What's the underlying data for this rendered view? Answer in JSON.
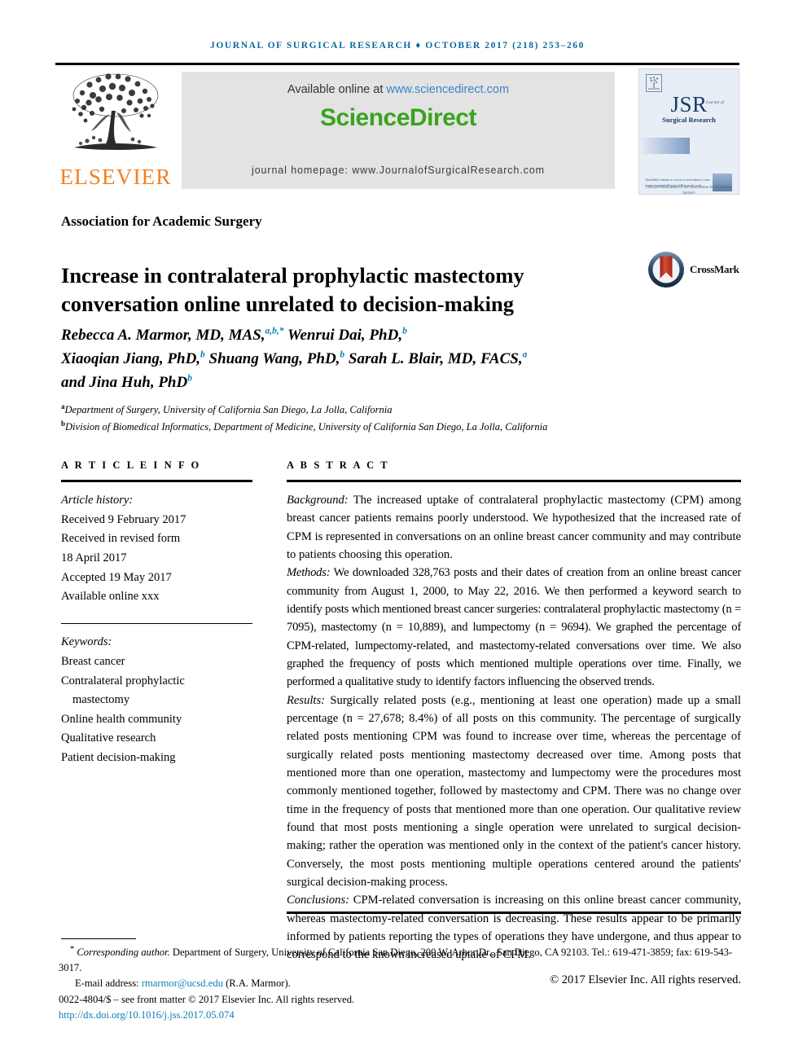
{
  "running_head": "JOURNAL OF SURGICAL RESEARCH ♦ OCTOBER 2017 (218) 253–260",
  "masthead": {
    "publisher_name": "ELSEVIER",
    "available_prefix": "Available online at",
    "sciencedirect_url": "www.sciencedirect.com",
    "sciencedirect_logo": "ScienceDirect",
    "journal_homepage": "journal homepage: www.JournalofSurgicalResearch.com",
    "cover": {
      "acronym": "JSR",
      "journal_word": "Journal of",
      "subtitle": "Surgical Research",
      "official_note": "Official Publication of the\nAssociation for Academic Surgery",
      "footer_note": "Available online at www.sciencedirect.com\nwww.JournalofSurgicalResearch.com"
    }
  },
  "society": "Association for Academic Surgery",
  "title": "Increase in contralateral prophylactic mastectomy conversation online unrelated to decision-making",
  "crossmark": {
    "label": "CrossMark"
  },
  "authors_line_1": "Rebecca A. Marmor, MD, MAS,",
  "authors": {
    "line1_sup": "a,b,*",
    "line1_rest": " Wenrui Dai, PhD,",
    "line1_rest_sup": "b",
    "line2_a": "Xiaoqian Jiang, PhD,",
    "line2_a_sup": "b",
    "line2_b": " Shuang Wang, PhD,",
    "line2_b_sup": "b",
    "line2_c": " Sarah L. Blair, MD, FACS,",
    "line2_c_sup": "a",
    "line3": "and Jina Huh, PhD",
    "line3_sup": "b"
  },
  "affiliations": [
    {
      "marker": "a",
      "text": "Department of Surgery, University of California San Diego, La Jolla, California"
    },
    {
      "marker": "b",
      "text": "Division of Biomedical Informatics, Department of Medicine, University of California San Diego, La Jolla, California"
    }
  ],
  "article_info": {
    "heading": "A R T I C L E   I N F O",
    "history_label": "Article history:",
    "history": [
      "Received 9 February 2017",
      "Received in revised form",
      "18 April 2017",
      "Accepted 19 May 2017",
      "Available online xxx"
    ],
    "keywords_label": "Keywords:",
    "keywords": [
      "Breast cancer",
      "Contralateral prophylactic",
      "mastectomy",
      "Online health community",
      "Qualitative research",
      "Patient decision-making"
    ]
  },
  "abstract": {
    "heading": "A B S T R A C T",
    "background_label": "Background:",
    "background": " The increased uptake of contralateral prophylactic mastectomy (CPM) among breast cancer patients remains poorly understood. We hypothesized that the increased rate of CPM is represented in conversations on an online breast cancer community and may contribute to patients choosing this operation.",
    "methods_label": "Methods:",
    "methods": " We downloaded 328,763 posts and their dates of creation from an online breast cancer community from August 1, 2000, to May 22, 2016. We then performed a keyword search to identify posts which mentioned breast cancer surgeries: contralateral prophylactic mastectomy (n = 7095), mastectomy (n = 10,889), and lumpectomy (n = 9694). We graphed the percentage of CPM-related, lumpectomy-related, and mastectomy-related conversations over time. We also graphed the frequency of posts which mentioned multiple operations over time. Finally, we performed a qualitative study to identify factors influencing the observed trends.",
    "results_label": "Results:",
    "results": " Surgically related posts (e.g., mentioning at least one operation) made up a small percentage (n = 27,678; 8.4%) of all posts on this community. The percentage of surgically related posts mentioning CPM was found to increase over time, whereas the percentage of surgically related posts mentioning mastectomy decreased over time. Among posts that mentioned more than one operation, mastectomy and lumpectomy were the procedures most commonly mentioned together, followed by mastectomy and CPM. There was no change over time in the frequency of posts that mentioned more than one operation. Our qualitative review found that most posts mentioning a single operation were unrelated to surgical decision-making; rather the operation was mentioned only in the context of the patient's cancer history. Conversely, the most posts mentioning multiple operations centered around the patients' surgical decision-making process.",
    "conclusions_label": "Conclusions:",
    "conclusions": " CPM-related conversation is increasing on this online breast cancer community, whereas mastectomy-related conversation is decreasing. These results appear to be primarily informed by patients reporting the types of operations they have undergone, and thus appear to correspond to the known increased uptake of CPM.",
    "copyright": "© 2017 Elsevier Inc. All rights reserved."
  },
  "footnotes": {
    "corresponding_marker": "*",
    "corresponding_label": "Corresponding author.",
    "corresponding_text": " Department of Surgery, University of California San Diego, 200 W. Arbor Dr., San Diego, CA 92103. Tel.: 619-471-3859; fax: 619-543-3017.",
    "email_label": "E-mail address:",
    "email": "rmarmor@ucsd.edu",
    "email_suffix": " (R.A. Marmor).",
    "issn_line": "0022-4804/$ – see front matter © 2017 Elsevier Inc. All rights reserved.",
    "doi": "http://dx.doi.org/10.1016/j.jss.2017.05.074"
  },
  "colors": {
    "header_blue": "#0b6a9c",
    "link_blue": "#0b7fb5",
    "sd_green": "#3aa31e",
    "sd_link": "#3b84c4",
    "elsevier_orange": "#f28021",
    "crossmark_circle": "#2a4a6b",
    "crossmark_ribbon": "#c0392b"
  }
}
